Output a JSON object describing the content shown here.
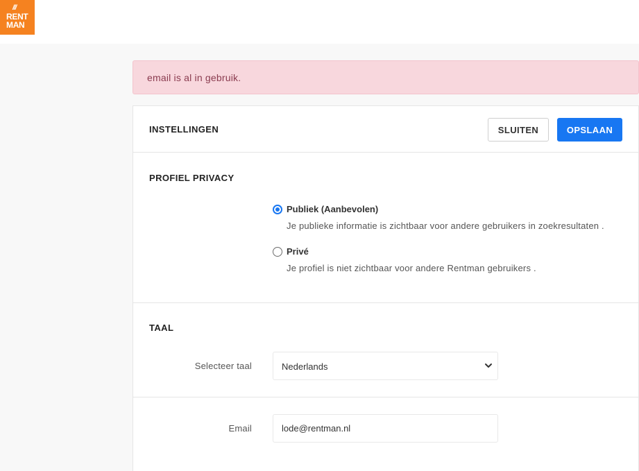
{
  "logo": {
    "stripes": "///",
    "line1": "RENT",
    "line2": "MAN",
    "color": "#f58220"
  },
  "alert": {
    "message": "email is al in gebruik."
  },
  "settings": {
    "title": "INSTELLINGEN",
    "close_label": "SLUITEN",
    "save_label": "OPSLAAN"
  },
  "privacy": {
    "title": "PROFIEL PRIVACY",
    "options": [
      {
        "label": "Publiek (Aanbevolen)",
        "description": "Je publieke informatie is zichtbaar voor andere gebruikers in zoekresultaten .",
        "checked": true
      },
      {
        "label": "Privé",
        "description": "Je profiel is niet zichtbaar voor andere Rentman gebruikers .",
        "checked": false
      }
    ]
  },
  "language": {
    "title": "TAAL",
    "select_label": "Selecteer taal",
    "selected": "Nederlands"
  },
  "email": {
    "label": "Email",
    "value": "lode@rentman.nl"
  },
  "colors": {
    "accent": "#1877f2",
    "alert_bg": "#f8d7dd",
    "alert_text": "#8a3b4f"
  }
}
